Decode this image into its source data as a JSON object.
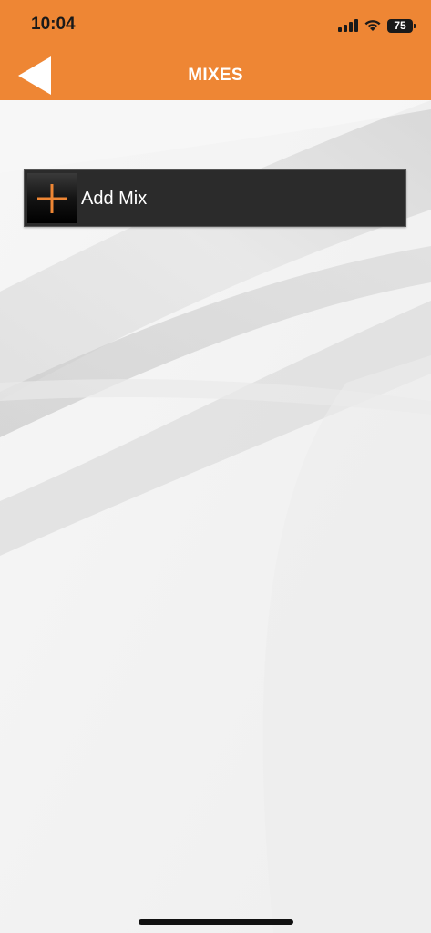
{
  "status_bar": {
    "time": "10:04",
    "battery_level": "75",
    "signal_icon": "cellular-signal-icon",
    "wifi_icon": "wifi-icon",
    "battery_icon": "battery-icon"
  },
  "nav": {
    "title": "MIXES",
    "back_icon": "back-triangle-icon"
  },
  "content": {
    "add_mix_label": "Add Mix",
    "add_mix_icon": "plus-icon"
  },
  "colors": {
    "accent": "#ee8634",
    "button_bg": "#2b2b2b",
    "plus": "#ee8634"
  }
}
